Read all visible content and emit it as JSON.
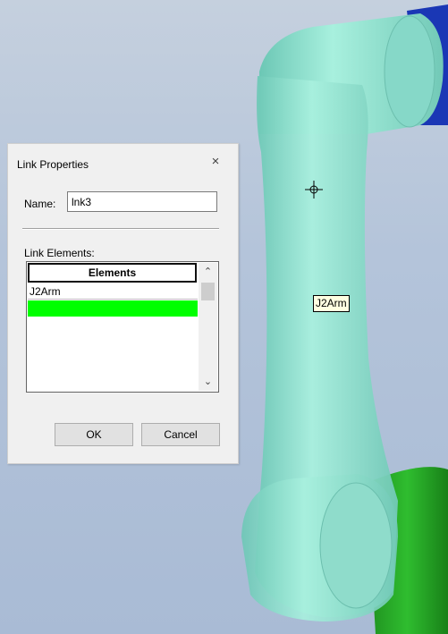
{
  "dialog": {
    "title": "Link Properties",
    "close_glyph": "×",
    "name_label": "Name:",
    "name_value": "lnk3",
    "link_elements_label": "Link Elements:",
    "table": {
      "column_header": "Elements",
      "rows": [
        "J2Arm",
        ""
      ],
      "selected_row_color": "#00ff00"
    },
    "ok_label": "OK",
    "cancel_label": "Cancel"
  },
  "viewport": {
    "tooltip": "J2Arm",
    "arm_color": "#8fe0cf",
    "joint_upper_color": "#1430b0",
    "joint_lower_color": "#1fa01f"
  }
}
